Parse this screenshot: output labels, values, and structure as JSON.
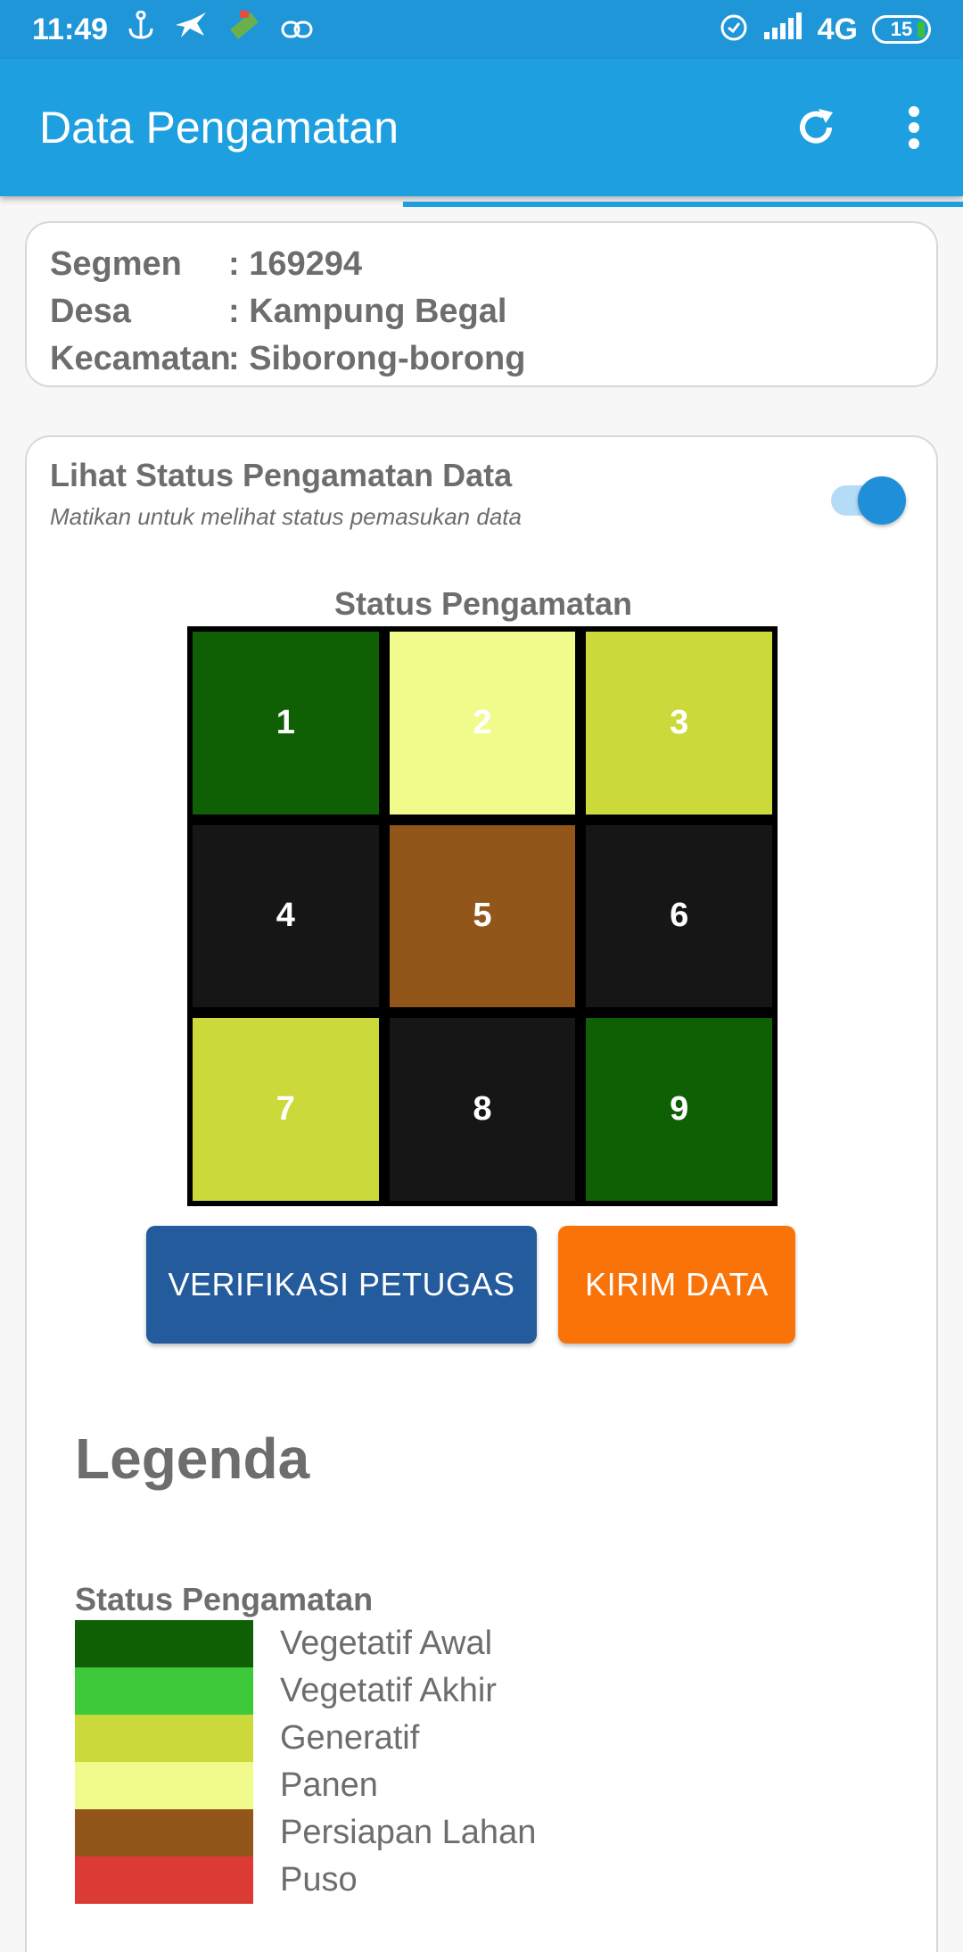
{
  "status_bar": {
    "time": "11:49",
    "network": "4G",
    "battery": "15"
  },
  "app_bar": {
    "title": "Data Pengamatan"
  },
  "info": {
    "rows": [
      {
        "key": "Segmen",
        "value": ": 169294"
      },
      {
        "key": "Desa",
        "value": ": Kampung Begal"
      },
      {
        "key": "Kecamatan",
        "value": ": Siborong-borong"
      }
    ]
  },
  "toggle": {
    "title": "Lihat Status Pengamatan Data",
    "subtitle": "Matikan untuk melihat status pemasukan data",
    "on": true
  },
  "grid": {
    "title": "Status Pengamatan",
    "cells": [
      {
        "label": "1",
        "color": "#0f5f05"
      },
      {
        "label": "2",
        "color": "#f1fb8c"
      },
      {
        "label": "3",
        "color": "#cbd93b"
      },
      {
        "label": "4",
        "color": "#161616"
      },
      {
        "label": "5",
        "color": "#93561a"
      },
      {
        "label": "6",
        "color": "#161616"
      },
      {
        "label": "7",
        "color": "#cbd93b"
      },
      {
        "label": "8",
        "color": "#161616"
      },
      {
        "label": "9",
        "color": "#0f5f05"
      }
    ]
  },
  "buttons": {
    "verify": "VERIFIKASI PETUGAS",
    "send": "KIRIM DATA"
  },
  "legend": {
    "title": "Legenda",
    "subtitle": "Status Pengamatan",
    "items": [
      {
        "label": "Vegetatif Awal",
        "color": "#0f5f05"
      },
      {
        "label": "Vegetatif Akhir",
        "color": "#3dc93a"
      },
      {
        "label": "Generatif",
        "color": "#cbd93b"
      },
      {
        "label": "Panen",
        "color": "#f1fb8c"
      },
      {
        "label": "Persiapan Lahan",
        "color": "#93561a"
      },
      {
        "label": "Puso",
        "color": "#db3a35"
      }
    ]
  }
}
